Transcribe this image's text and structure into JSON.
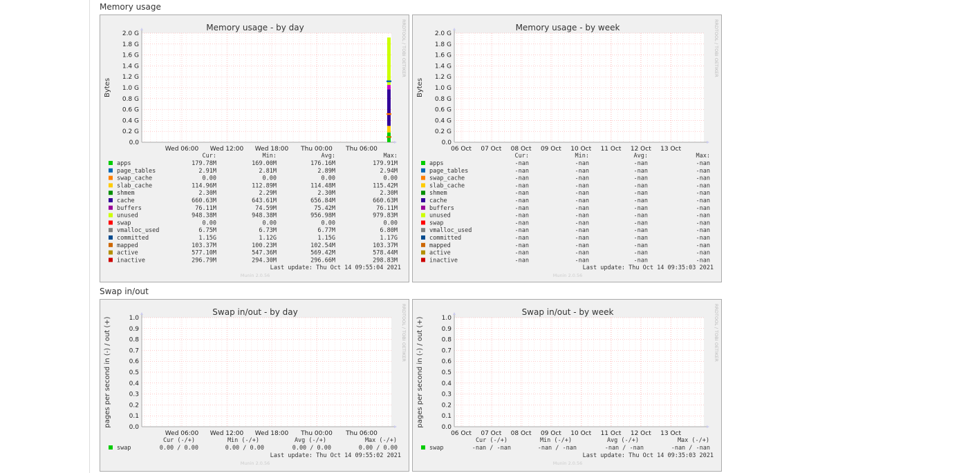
{
  "sections": [
    {
      "title": "Memory usage"
    },
    {
      "title": "Swap in/out"
    }
  ],
  "stats_headers": {
    "memory": [
      "Cur:",
      "Min:",
      "Avg:",
      "Max:"
    ],
    "swap": [
      "Cur (-/+)",
      "Min (-/+)",
      "Avg (-/+)",
      "Max (-/+)"
    ]
  },
  "chart_data": [
    {
      "type": "area",
      "title": "Memory usage - by day",
      "ylabel": "Bytes",
      "side_text": "RRDTOOL / TOBI OETIKER",
      "footer": "Munin 2.0.56",
      "ylim": [
        0,
        2.0
      ],
      "y_ticks": [
        "0.0",
        "0.2 G",
        "0.4 G",
        "0.6 G",
        "0.8 G",
        "1.0 G",
        "1.2 G",
        "1.4 G",
        "1.6 G",
        "1.8 G",
        "2.0 G"
      ],
      "x_ticks": [
        "Wed 06:00",
        "Wed 12:00",
        "Wed 18:00",
        "Thu 00:00",
        "Thu 06:00"
      ],
      "last_update": "Last update: Thu Oct 14 09:55:04 2021",
      "stack_segments": [
        {
          "color": "#00cc00",
          "from": 0.0,
          "to": 0.18
        },
        {
          "color": "#ffcc00",
          "from": 0.18,
          "to": 0.3
        },
        {
          "color": "#330099",
          "from": 0.3,
          "to": 0.97
        },
        {
          "color": "#cc00cc",
          "from": 0.97,
          "to": 1.05
        },
        {
          "color": "#ccff00",
          "from": 1.05,
          "to": 1.92
        }
      ],
      "stack_markers": [
        {
          "color": "#ff7700",
          "at": 0.52
        },
        {
          "color": "#0066b3",
          "at": 1.12
        },
        {
          "color": "#cc7700",
          "at": 0.1
        }
      ],
      "series": [
        {
          "name": "apps",
          "color": "#00cc00",
          "cur": "179.78M",
          "min": "169.00M",
          "avg": "176.16M",
          "max": "179.91M"
        },
        {
          "name": "page_tables",
          "color": "#0066b3",
          "cur": "2.91M",
          "min": "2.81M",
          "avg": "2.89M",
          "max": "2.94M"
        },
        {
          "name": "swap_cache",
          "color": "#ff8000",
          "cur": "0.00",
          "min": "0.00",
          "avg": "0.00",
          "max": "0.00"
        },
        {
          "name": "slab_cache",
          "color": "#ffcc00",
          "cur": "114.96M",
          "min": "112.89M",
          "avg": "114.48M",
          "max": "115.42M"
        },
        {
          "name": "shmem",
          "color": "#008f00",
          "cur": "2.30M",
          "min": "2.29M",
          "avg": "2.30M",
          "max": "2.30M"
        },
        {
          "name": "cache",
          "color": "#330099",
          "cur": "660.63M",
          "min": "643.61M",
          "avg": "656.84M",
          "max": "660.63M"
        },
        {
          "name": "buffers",
          "color": "#990099",
          "cur": "76.11M",
          "min": "74.59M",
          "avg": "75.42M",
          "max": "76.11M"
        },
        {
          "name": "unused",
          "color": "#ccff00",
          "cur": "948.38M",
          "min": "948.38M",
          "avg": "956.98M",
          "max": "979.83M"
        },
        {
          "name": "swap",
          "color": "#ff0000",
          "cur": "0.00",
          "min": "0.00",
          "avg": "0.00",
          "max": "0.00"
        },
        {
          "name": "vmalloc_used",
          "color": "#808080",
          "cur": "6.75M",
          "min": "6.73M",
          "avg": "6.77M",
          "max": "6.80M"
        },
        {
          "name": "committed",
          "color": "#004b8f",
          "cur": "1.15G",
          "min": "1.12G",
          "avg": "1.15G",
          "max": "1.17G"
        },
        {
          "name": "mapped",
          "color": "#cc6600",
          "cur": "103.37M",
          "min": "100.23M",
          "avg": "102.54M",
          "max": "103.37M"
        },
        {
          "name": "active",
          "color": "#b38f00",
          "cur": "577.10M",
          "min": "547.36M",
          "avg": "569.42M",
          "max": "578.44M"
        },
        {
          "name": "inactive",
          "color": "#cc0000",
          "cur": "296.79M",
          "min": "294.30M",
          "avg": "296.66M",
          "max": "298.83M"
        }
      ]
    },
    {
      "type": "area",
      "title": "Memory usage - by week",
      "ylabel": "Bytes",
      "side_text": "RRDTOOL / TOBI OETIKER",
      "footer": "Munin 2.0.56",
      "ylim": [
        0,
        2.0
      ],
      "y_ticks": [
        "0.0",
        "0.2 G",
        "0.4 G",
        "0.6 G",
        "0.8 G",
        "1.0 G",
        "1.2 G",
        "1.4 G",
        "1.6 G",
        "1.8 G",
        "2.0 G"
      ],
      "x_ticks": [
        "06 Oct",
        "07 Oct",
        "08 Oct",
        "09 Oct",
        "10 Oct",
        "11 Oct",
        "12 Oct",
        "13 Oct"
      ],
      "last_update": "Last update: Thu Oct 14 09:35:03 2021",
      "stack_segments": [],
      "stack_markers": [],
      "series": [
        {
          "name": "apps",
          "color": "#00cc00",
          "cur": "-nan",
          "min": "-nan",
          "avg": "-nan",
          "max": "-nan"
        },
        {
          "name": "page_tables",
          "color": "#0066b3",
          "cur": "-nan",
          "min": "-nan",
          "avg": "-nan",
          "max": "-nan"
        },
        {
          "name": "swap_cache",
          "color": "#ff8000",
          "cur": "-nan",
          "min": "-nan",
          "avg": "-nan",
          "max": "-nan"
        },
        {
          "name": "slab_cache",
          "color": "#ffcc00",
          "cur": "-nan",
          "min": "-nan",
          "avg": "-nan",
          "max": "-nan"
        },
        {
          "name": "shmem",
          "color": "#008f00",
          "cur": "-nan",
          "min": "-nan",
          "avg": "-nan",
          "max": "-nan"
        },
        {
          "name": "cache",
          "color": "#330099",
          "cur": "-nan",
          "min": "-nan",
          "avg": "-nan",
          "max": "-nan"
        },
        {
          "name": "buffers",
          "color": "#990099",
          "cur": "-nan",
          "min": "-nan",
          "avg": "-nan",
          "max": "-nan"
        },
        {
          "name": "unused",
          "color": "#ccff00",
          "cur": "-nan",
          "min": "-nan",
          "avg": "-nan",
          "max": "-nan"
        },
        {
          "name": "swap",
          "color": "#ff0000",
          "cur": "-nan",
          "min": "-nan",
          "avg": "-nan",
          "max": "-nan"
        },
        {
          "name": "vmalloc_used",
          "color": "#808080",
          "cur": "-nan",
          "min": "-nan",
          "avg": "-nan",
          "max": "-nan"
        },
        {
          "name": "committed",
          "color": "#004b8f",
          "cur": "-nan",
          "min": "-nan",
          "avg": "-nan",
          "max": "-nan"
        },
        {
          "name": "mapped",
          "color": "#cc6600",
          "cur": "-nan",
          "min": "-nan",
          "avg": "-nan",
          "max": "-nan"
        },
        {
          "name": "active",
          "color": "#b38f00",
          "cur": "-nan",
          "min": "-nan",
          "avg": "-nan",
          "max": "-nan"
        },
        {
          "name": "inactive",
          "color": "#cc0000",
          "cur": "-nan",
          "min": "-nan",
          "avg": "-nan",
          "max": "-nan"
        }
      ]
    },
    {
      "type": "line",
      "title": "Swap in/out - by day",
      "ylabel": "pages per second in (-) / out (+)",
      "side_text": "RRDTOOL / TOBI OETIKER",
      "footer": "Munin 2.0.56",
      "ylim": [
        0,
        1.0
      ],
      "y_ticks": [
        "0.0",
        "0.1",
        "0.2",
        "0.3",
        "0.4",
        "0.5",
        "0.6",
        "0.7",
        "0.8",
        "0.9",
        "1.0"
      ],
      "x_ticks": [
        "Wed 06:00",
        "Wed 12:00",
        "Wed 18:00",
        "Thu 00:00",
        "Thu 06:00"
      ],
      "last_update": "Last update: Thu Oct 14 09:55:02 2021",
      "series": [
        {
          "name": "swap",
          "color": "#00cc00",
          "cur": "0.00 /   0.00",
          "min": "0.00 /   0.00",
          "avg": "0.00 /   0.00",
          "max": "0.00 /   0.00"
        }
      ]
    },
    {
      "type": "line",
      "title": "Swap in/out - by week",
      "ylabel": "pages per second in (-) / out (+)",
      "side_text": "RRDTOOL / TOBI OETIKER",
      "footer": "Munin 2.0.56",
      "ylim": [
        0,
        1.0
      ],
      "y_ticks": [
        "0.0",
        "0.1",
        "0.2",
        "0.3",
        "0.4",
        "0.5",
        "0.6",
        "0.7",
        "0.8",
        "0.9",
        "1.0"
      ],
      "x_ticks": [
        "06 Oct",
        "07 Oct",
        "08 Oct",
        "09 Oct",
        "10 Oct",
        "11 Oct",
        "12 Oct",
        "13 Oct"
      ],
      "last_update": "Last update: Thu Oct 14 09:35:03 2021",
      "series": [
        {
          "name": "swap",
          "color": "#00cc00",
          "cur": "-nan /   -nan",
          "min": "-nan /   -nan",
          "avg": "-nan /   -nan",
          "max": "-nan /   -nan"
        }
      ]
    }
  ]
}
